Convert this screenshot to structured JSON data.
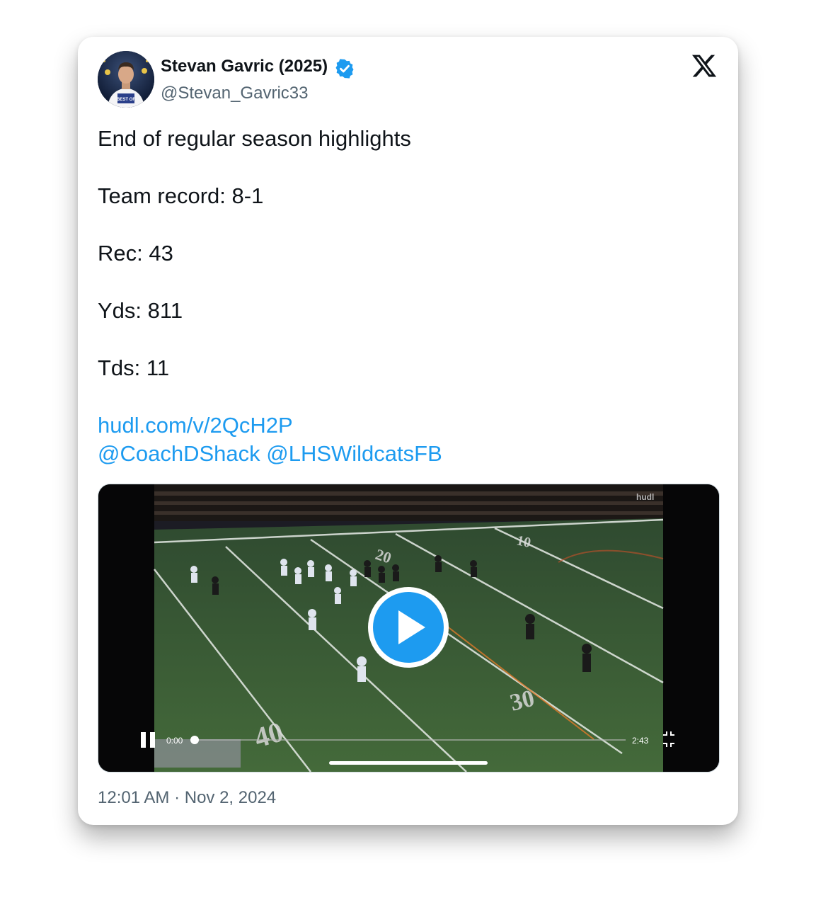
{
  "author": {
    "display_name": "Stevan Gavric (2025)",
    "handle": "@Stevan_Gavric33",
    "verified": true,
    "avatar_shirt_text": "BEST OF"
  },
  "platform_icon": "x-logo-icon",
  "tweet": {
    "lines": [
      "End of regular season highlights",
      "Team record: 8-1",
      "Rec: 43",
      "Yds: 811",
      "Tds: 11"
    ],
    "link": "hudl.com/v/2QcH2P",
    "mentions": [
      "@CoachDShack",
      "@LHSWildcatsFB"
    ]
  },
  "video": {
    "watermark": "hudl",
    "current_time": "0:00",
    "duration": "2:43",
    "progress": 0,
    "yard_numbers": [
      "20",
      "10",
      "30",
      "40"
    ],
    "controls": [
      "pause-icon",
      "play-icon",
      "exit-fullscreen-icon"
    ]
  },
  "timestamp": {
    "time": "12:01 AM",
    "separator": " · ",
    "date": "Nov 2, 2024"
  },
  "colors": {
    "link": "#1d9bf0",
    "verified": "#1d9bf0",
    "text": "#0f1419",
    "secondary": "#536471",
    "field": "#3b5a34"
  }
}
